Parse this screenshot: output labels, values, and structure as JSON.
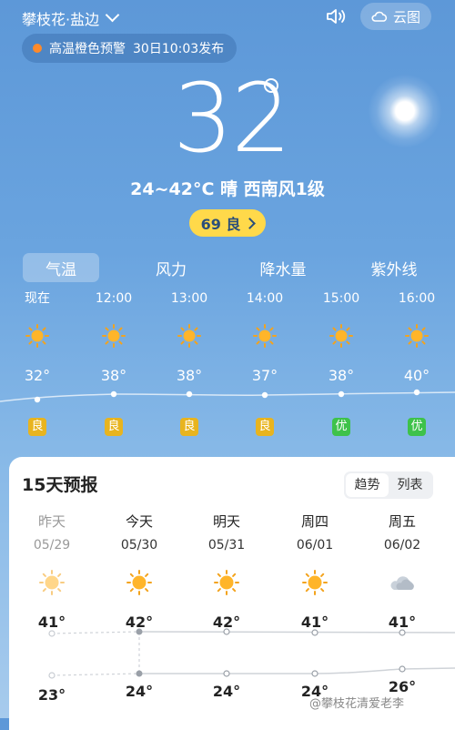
{
  "header": {
    "location": "攀枝花·盐边",
    "cloud_map_label": "云图"
  },
  "alert": {
    "title": "高温橙色预警",
    "time": "30日10:03发布",
    "color": "#ff8a2a"
  },
  "current": {
    "temp": "32",
    "summary": "24~42°C 晴 西南风1级",
    "aqi_label": "69 良",
    "aqi_color": "#ffd94a"
  },
  "tabs": [
    "气温",
    "风力",
    "降水量",
    "紫外线"
  ],
  "active_tab": "气温",
  "hourly": [
    {
      "time": "现在",
      "temp": "32°",
      "aqi": "良",
      "aqi_color": "#e8b41f",
      "icon": "sun-icon"
    },
    {
      "time": "12:00",
      "temp": "38°",
      "aqi": "良",
      "aqi_color": "#e8b41f",
      "icon": "sun-icon"
    },
    {
      "time": "13:00",
      "temp": "38°",
      "aqi": "良",
      "aqi_color": "#e8b41f",
      "icon": "sun-icon"
    },
    {
      "time": "14:00",
      "temp": "37°",
      "aqi": "良",
      "aqi_color": "#e8b41f",
      "icon": "sun-icon"
    },
    {
      "time": "15:00",
      "temp": "38°",
      "aqi": "优",
      "aqi_color": "#3ec24a",
      "icon": "sun-icon"
    },
    {
      "time": "16:00",
      "temp": "40°",
      "aqi": "优",
      "aqi_color": "#3ec24a",
      "icon": "sun-icon"
    }
  ],
  "forecast": {
    "title": "15天预报",
    "views": [
      "趋势",
      "列表"
    ],
    "active_view": "趋势",
    "days": [
      {
        "day": "昨天",
        "date": "05/29",
        "high": "41°",
        "low": "23°",
        "icon": "sun-icon",
        "past": true
      },
      {
        "day": "今天",
        "date": "05/30",
        "high": "42°",
        "low": "24°",
        "icon": "sun-icon",
        "past": false
      },
      {
        "day": "明天",
        "date": "05/31",
        "high": "42°",
        "low": "24°",
        "icon": "sun-icon",
        "past": false
      },
      {
        "day": "周四",
        "date": "06/01",
        "high": "41°",
        "low": "24°",
        "icon": "sun-icon",
        "past": false
      },
      {
        "day": "周五",
        "date": "06/02",
        "high": "41°",
        "low": "26°",
        "icon": "cloud-icon",
        "past": false
      }
    ]
  },
  "watermark": "@攀枝花清爱老李"
}
